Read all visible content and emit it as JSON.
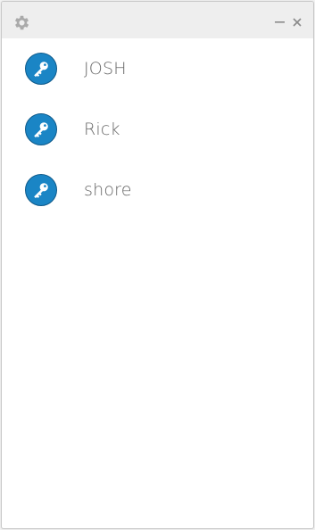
{
  "titlebar": {
    "settings_icon": "gear-icon",
    "minimize_icon": "minimize-icon",
    "close_icon": "close-icon",
    "icon_color": "#9a9a9a"
  },
  "list": {
    "items": [
      {
        "label": "JOSH",
        "icon": "key-icon"
      },
      {
        "label": "Rick",
        "icon": "key-icon"
      },
      {
        "label": "shore",
        "icon": "key-icon"
      }
    ]
  },
  "colors": {
    "accent": "#1a85c5",
    "titlebar_bg": "#eeeeee",
    "text": "#666666"
  }
}
